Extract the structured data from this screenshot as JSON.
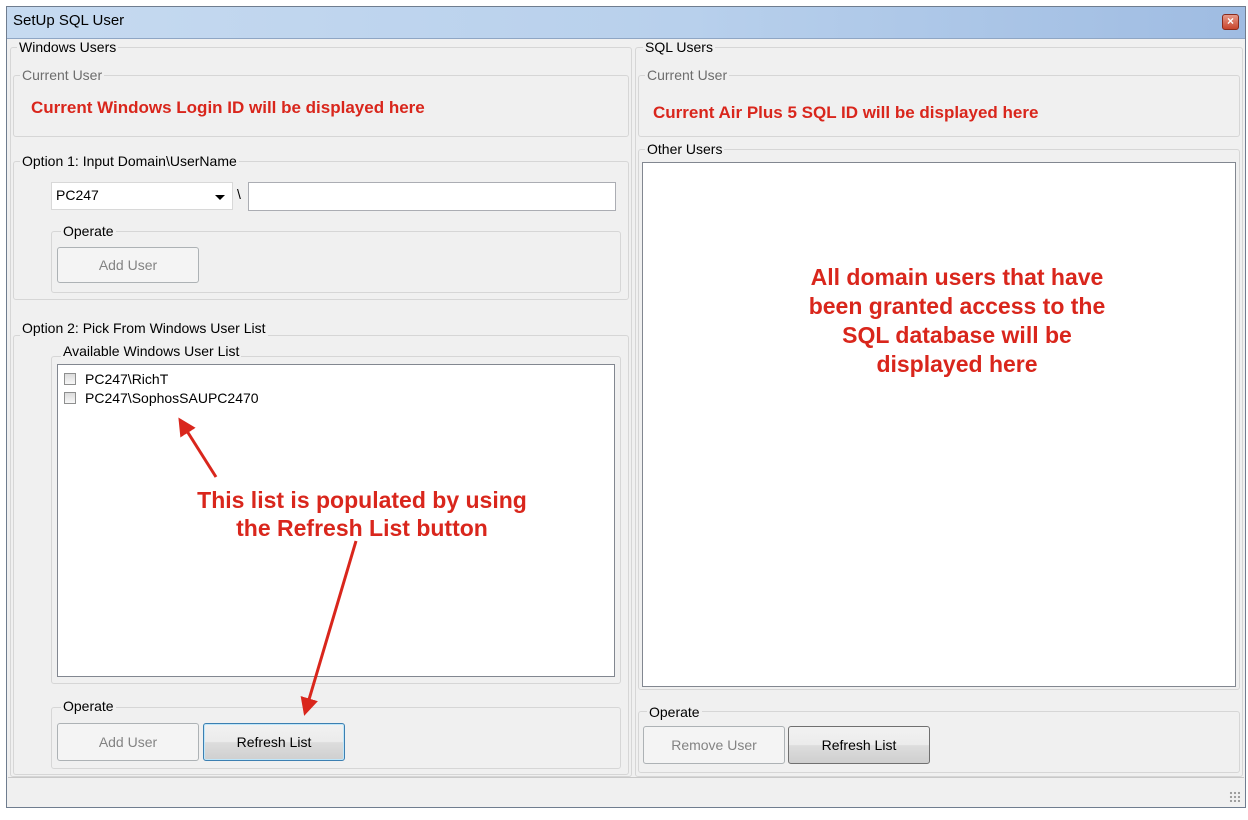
{
  "window": {
    "title": "SetUp SQL User",
    "close_glyph": "×"
  },
  "windows_users": {
    "label": "Windows Users",
    "current_user": {
      "label": "Current User",
      "note": "Current Windows Login ID will be displayed here"
    },
    "option1": {
      "label": "Option 1: Input Domain\\UserName",
      "domain_value": "PC247",
      "separator": "\\",
      "username_value": "",
      "operate_label": "Operate",
      "add_user_label": "Add User"
    },
    "option2": {
      "label": "Option 2: Pick From Windows User List",
      "list_label": "Available Windows User List",
      "items": [
        {
          "label": "PC247\\RichT",
          "checked": false
        },
        {
          "label": "PC247\\SophosSAUPC2470",
          "checked": false
        }
      ],
      "annotation_line1": "This list is populated by using",
      "annotation_line2": "the Refresh List button",
      "operate_label": "Operate",
      "add_user_label": "Add User",
      "refresh_label": "Refresh List"
    }
  },
  "sql_users": {
    "label": "SQL Users",
    "current_user": {
      "label": "Current User",
      "note": "Current Air Plus 5 SQL ID will be displayed here"
    },
    "other_users": {
      "label": "Other Users",
      "annotation_line1": "All domain users that have",
      "annotation_line2": "been granted access to the",
      "annotation_line3": "SQL database will be",
      "annotation_line4": "displayed here"
    },
    "operate_label": "Operate",
    "remove_user_label": "Remove User",
    "refresh_label": "Refresh List"
  },
  "colors": {
    "annotation_red": "#d9261c",
    "titlebar": "#b8d0ec"
  },
  "icons": {
    "close": "close-icon",
    "dropdown": "chevron-down-icon",
    "resize": "resize-grip-icon"
  }
}
